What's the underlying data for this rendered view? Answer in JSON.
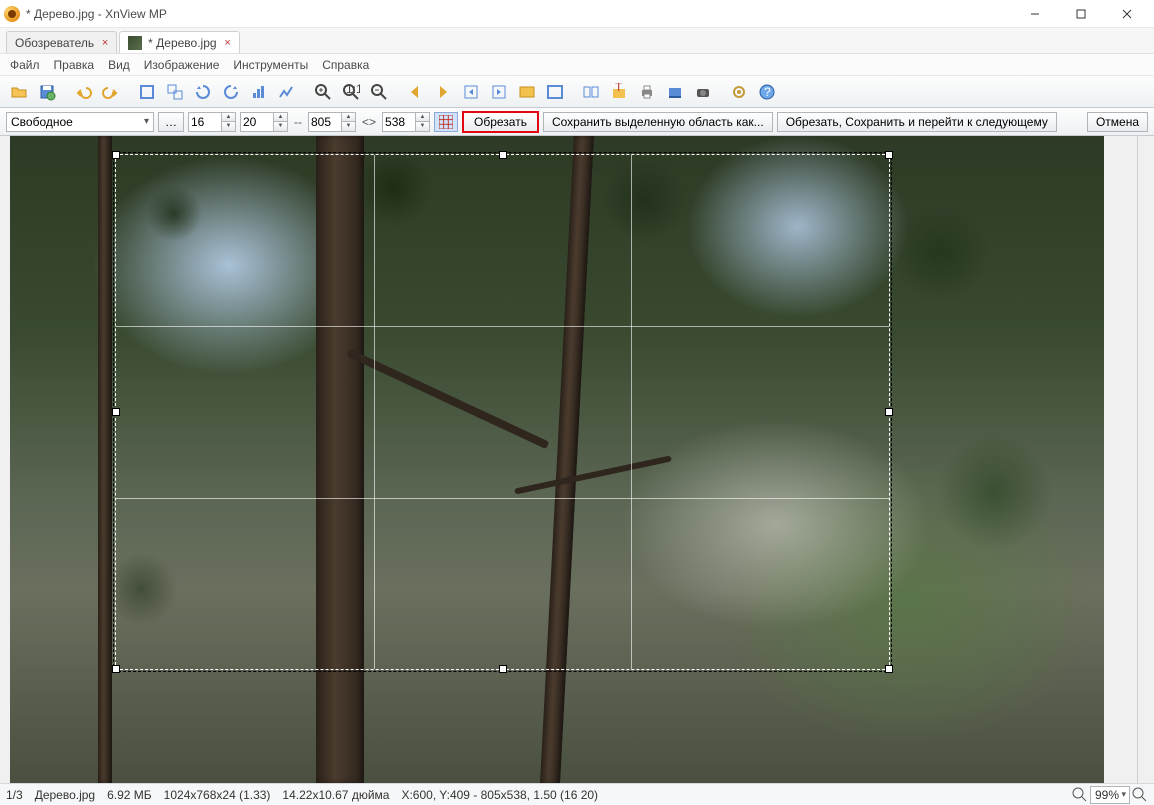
{
  "window": {
    "title": "* Дерево.jpg - XnView MP"
  },
  "tabs": [
    {
      "label": "Обозреватель",
      "has_thumb": false
    },
    {
      "label": "* Дерево.jpg",
      "has_thumb": true
    }
  ],
  "menu": [
    "Файл",
    "Правка",
    "Вид",
    "Изображение",
    "Инструменты",
    "Справка"
  ],
  "crop": {
    "mode": "Свободное",
    "x": "16",
    "y": "20",
    "w": "805",
    "h": "538",
    "ellipsis": "…",
    "dash": "--",
    "swap": "<>",
    "btn_crop": "Обрезать",
    "btn_save_sel": "Сохранить выделенную область как...",
    "btn_crop_next": "Обрезать, Сохранить и перейти к следующему",
    "btn_cancel": "Отмена"
  },
  "status": {
    "index": "1/3",
    "file": "Дерево.jpg",
    "size": "6.92 МБ",
    "dims": "1024x768x24 (1.33)",
    "phys": "14.22x10.67 дюйма",
    "cursor": "X:600, Y:409 - 805x538, 1.50 (16 20)",
    "zoom": "99%"
  }
}
